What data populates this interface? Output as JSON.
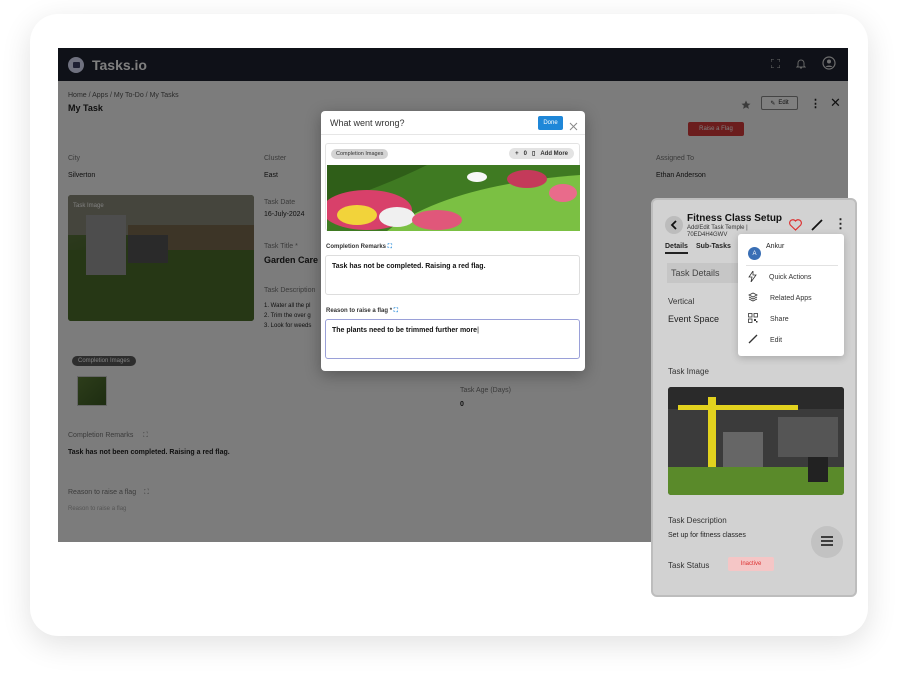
{
  "app": {
    "brand": "Tasks.io"
  },
  "page": {
    "breadcrumb": "Home / Apps / My To-Do / My Tasks",
    "title": "My Task",
    "edit_label": "Edit",
    "raise_flag_label": "Raise a Flag"
  },
  "details": {
    "city_label": "City",
    "city_value": "Silverton",
    "cluster_label": "Cluster",
    "cluster_value": "East",
    "assigned_label": "Assigned To",
    "assigned_value": "Ethan Anderson",
    "task_image_label": "Task Image",
    "task_date_label": "Task Date",
    "task_date_value": "16-July-2024",
    "task_title_label": "Task Title *",
    "task_title_value": "Garden Care",
    "task_desc_label": "Task Description",
    "task_desc_lines": [
      "1. Water all the pl",
      "2. Trim the over g",
      "3. Look for weeds"
    ],
    "completion_images_label": "Completion Images",
    "task_age_label": "Task Age (Days)",
    "task_age_value": "0",
    "completion_remarks_label": "Completion Remarks",
    "completion_remarks_value": "Task has not been completed. Raising a red flag.",
    "reason_label": "Reason to raise a flag",
    "reason_placeholder": "Reason to raise a flag"
  },
  "modal": {
    "title": "What went wrong?",
    "done_label": "Done",
    "completion_images_label": "Completion Images",
    "count": "0",
    "add_more_label": "Add More",
    "remarks_label": "Completion Remarks",
    "remarks_value": "Task has not be completed. Raising a red flag.",
    "reason_label": "Reason to raise a flag *",
    "reason_value": "The plants need to be trimmed further more"
  },
  "mobile": {
    "title": "Fitness Class Setup",
    "subtitle_1": "Add/Edit Task Temple |",
    "subtitle_2": "70ED4H4GWV",
    "tab_details": "Details",
    "tab_subtasks": "Sub-Tasks",
    "section_title": "Task Details",
    "vertical_label": "Vertical",
    "vertical_value": "Event Space",
    "task_image_label": "Task Image",
    "task_desc_label": "Task Description",
    "task_desc_value": "Set up for fitness classes",
    "task_status_label": "Task Status",
    "task_status_value": "Inactive",
    "status_color": "#d33333"
  },
  "menu": {
    "user_initial": "A",
    "user_name": "Ankur",
    "items": [
      {
        "label": "Quick Actions",
        "icon": "bolt-icon"
      },
      {
        "label": "Related Apps",
        "icon": "layers-icon"
      },
      {
        "label": "Share",
        "icon": "qr-code-icon"
      },
      {
        "label": "Edit",
        "icon": "pencil-icon"
      }
    ]
  },
  "colors": {
    "topbar": "#1e2230",
    "primary": "#1f87d8",
    "flag": "#d63b3b"
  }
}
